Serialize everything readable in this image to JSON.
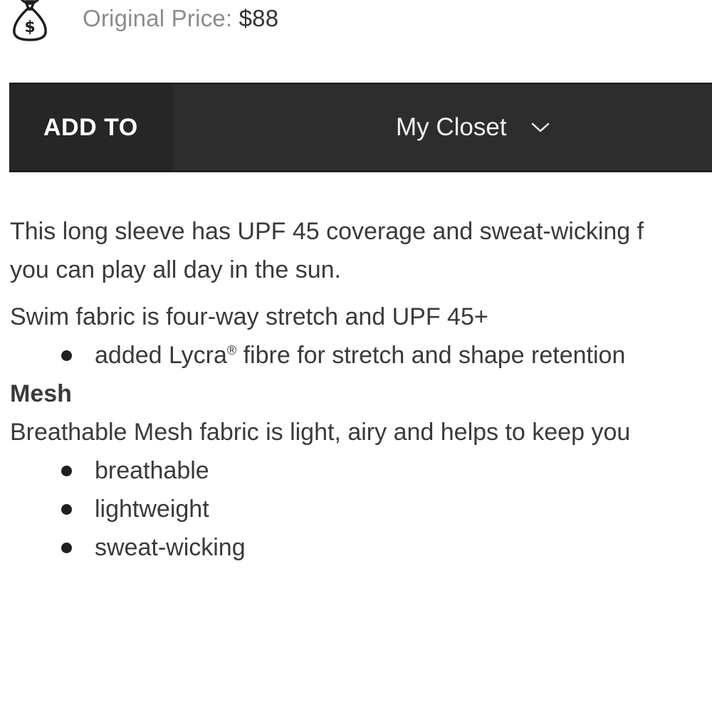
{
  "price": {
    "icon": "money-bag-icon",
    "label": "Original Price:",
    "value": "$88"
  },
  "add_bar": {
    "add_label": "ADD TO",
    "selected_list": "My Closet",
    "chevron_icon": "chevron-down-icon",
    "background_color": "#2d2d2d"
  },
  "description": {
    "intro": "This long sleeve has UPF 45 coverage and sweat-wicking f",
    "intro_line2": "you can play all day in the sun.",
    "swim": {
      "text": "Swim fabric is  four-way stretch and UPF 45+",
      "items": [
        {
          "before": "added Lycra",
          "mark": "®",
          "after": " fibre for stretch and shape retention"
        }
      ]
    },
    "mesh": {
      "heading": "Mesh",
      "text": "Breathable Mesh fabric is light, airy and helps to keep you",
      "items": [
        "breathable",
        "lightweight",
        "sweat-wicking"
      ]
    }
  }
}
